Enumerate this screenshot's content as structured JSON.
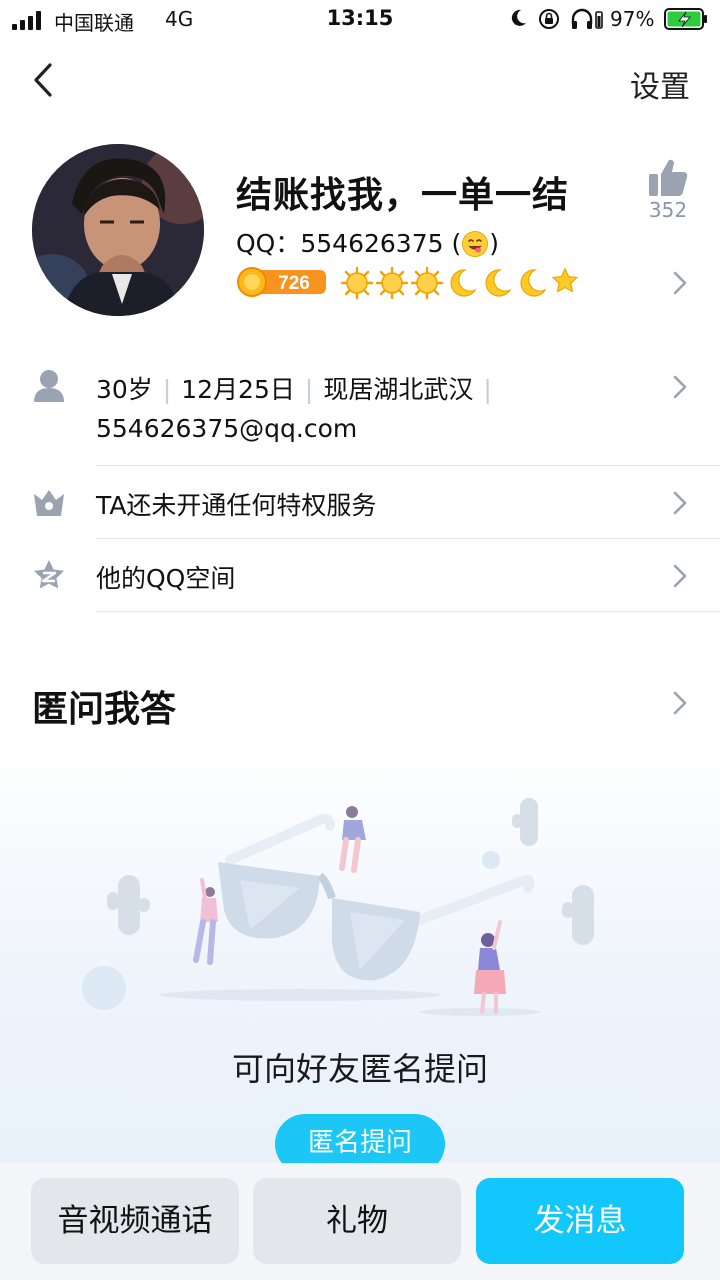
{
  "status_bar": {
    "carrier": "中国联通",
    "network": "4G",
    "time": "13:15",
    "battery_percent": "97%"
  },
  "header": {
    "settings_label": "设置"
  },
  "profile": {
    "nickname": "结账找我，一单一结",
    "qq_prefix": "QQ：",
    "qq_number": "554626375",
    "qq_suffix_open": " (",
    "qq_suffix_close": ")",
    "level_number": "726",
    "level_icons": [
      "sun-icon",
      "sun-icon",
      "sun-icon",
      "moon-icon",
      "moon-icon",
      "moon-icon",
      "star-icon"
    ],
    "like_count": "352"
  },
  "info": {
    "age": "30岁",
    "birthday": "12月25日",
    "location": "现居湖北武汉",
    "email": "554626375@qq.com",
    "privilege_text": "TA还未开通任何特权服务",
    "qzone_text": "他的QQ空间"
  },
  "anonymous": {
    "title": "匿问我答",
    "empty_text": "可向好友匿名提问",
    "ask_button": "匿名提问"
  },
  "bottom_bar": {
    "call_label": "音视频通话",
    "gift_label": "礼物",
    "message_label": "发消息"
  },
  "colors": {
    "accent": "#12c7fb",
    "level_badge": "#f7931e",
    "secondary_text": "#8c96a6",
    "battery_green": "#2ecc40"
  }
}
